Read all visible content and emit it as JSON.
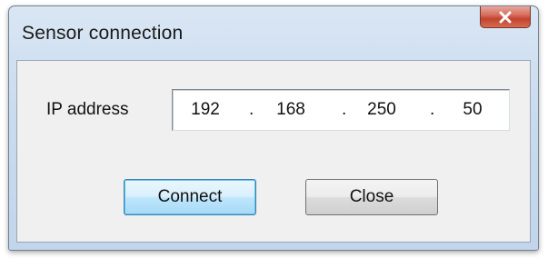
{
  "window": {
    "title": "Sensor connection",
    "close_icon": "close-x-icon"
  },
  "form": {
    "ip_label": "IP address",
    "ip_octets": [
      "192",
      "168",
      "250",
      "50"
    ],
    "separator": "."
  },
  "buttons": {
    "connect_label": "Connect",
    "close_label": "Close"
  },
  "colors": {
    "title_bar": "#c9dbee",
    "close_button": "#c2442f",
    "default_button_border": "#3c7fb1"
  }
}
